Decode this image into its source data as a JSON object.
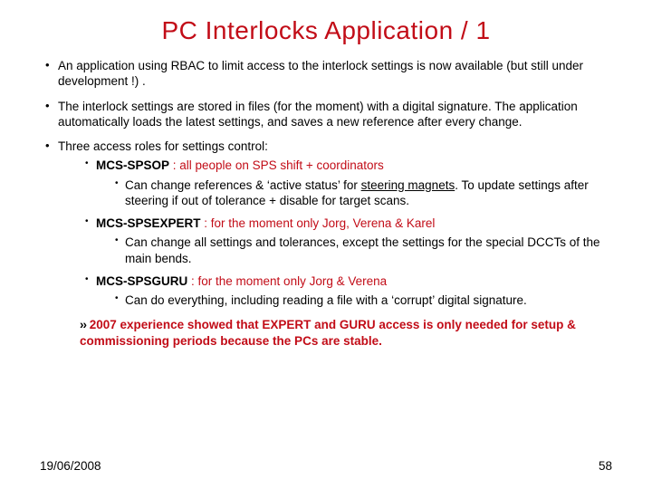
{
  "title": "PC Interlocks Application / 1",
  "bullets": {
    "b1": "An application using RBAC to limit access to the interlock settings is now available (but still under development !) .",
    "b2": "The interlock settings are stored in files (for the moment) with a digital signature. The application automatically loads the latest settings, and saves a new reference after every change.",
    "b3": "Three access roles for settings control:"
  },
  "roles": {
    "r1": {
      "name": "MCS-SPSOP",
      "rest": " : all people on SPS shift + coordinators",
      "sub_pre": "Can change references & ‘active status’ for ",
      "sub_u": "steering magnets",
      "sub_post": ". To update settings after steering if out of tolerance + disable for target scans."
    },
    "r2": {
      "name": "MCS-SPSEXPERT",
      "rest": " : for the moment only Jorg, Verena & Karel",
      "sub": "Can change all settings and tolerances, except the settings for the special DCCTs of the main bends."
    },
    "r3": {
      "name": "MCS-SPSGURU",
      "rest": " : for the moment only Jorg & Verena",
      "sub": "Can do everything, including reading a file with a ‘corrupt’ digital signature."
    }
  },
  "conclusion": {
    "arrows": "››",
    "text": " 2007 experience showed that EXPERT and GURU access is only needed for setup & commissioning periods because the PCs are stable."
  },
  "footer": {
    "date": "19/06/2008",
    "page": "58"
  }
}
